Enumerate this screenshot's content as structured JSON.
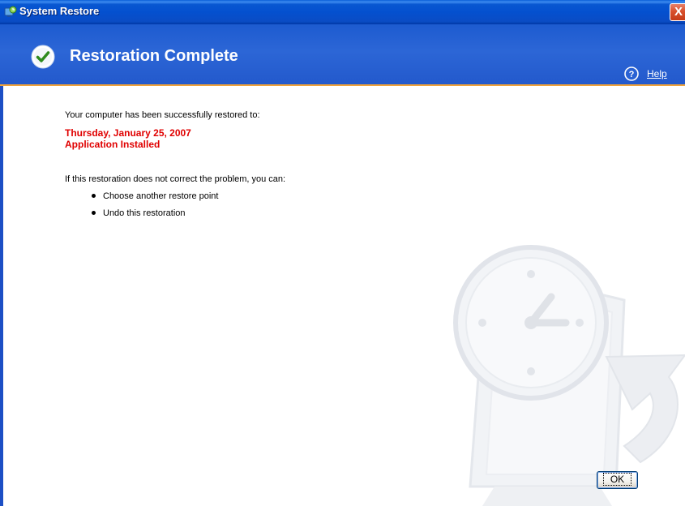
{
  "window": {
    "title": "System Restore",
    "close_label": "X"
  },
  "header": {
    "title": "Restoration Complete",
    "help_label": "Help"
  },
  "content": {
    "intro": "Your computer has been successfully restored to:",
    "restore_date": "Thursday, January 25, 2007",
    "restore_description": "Application Installed",
    "options_intro": "If this restoration does not correct the problem, you can:",
    "options": [
      {
        "label": "Choose another restore point"
      },
      {
        "label": "Undo this restoration"
      }
    ]
  },
  "footer": {
    "ok_label": "OK"
  },
  "icons": {
    "title": "system-restore-icon",
    "header": "checkmark-icon",
    "help": "help-icon",
    "watermark": "clock-restore-illustration"
  },
  "colors": {
    "title_bar": "#0450cf",
    "header_band": "#2c66d6",
    "header_accent": "#f0a23a",
    "restore_point_text": "#e00000",
    "close_button": "#d8502d"
  }
}
